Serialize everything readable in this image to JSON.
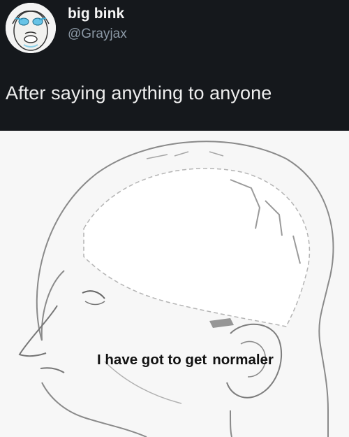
{
  "tweet": {
    "display_name": "big bink",
    "handle": "@Grayjax",
    "text": "After saying anything to anyone"
  },
  "meme": {
    "caption_part1": "I have got to get",
    "caption_part2": "normaler"
  },
  "colors": {
    "background": "#16181d",
    "text_primary": "#e7e9ea",
    "text_secondary": "#8b98a5",
    "meme_background": "#f7f7f7"
  },
  "icons": {
    "avatar": "cartoon-face-avatar",
    "meme_image": "head-profile-brain-drawing"
  }
}
